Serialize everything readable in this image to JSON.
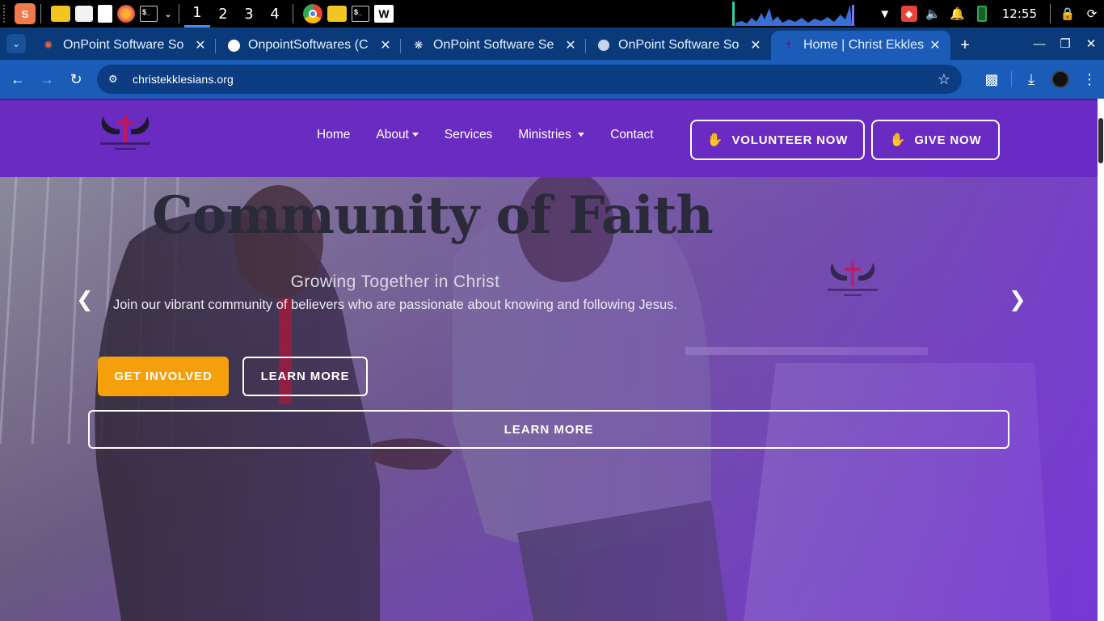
{
  "taskbar": {
    "workspaces": [
      "1",
      "2",
      "3",
      "4"
    ],
    "active_workspace": "1",
    "clock": "12:55"
  },
  "browser": {
    "tabs": [
      {
        "title": "OnPoint Software So",
        "icon": "onpoint-spark-icon",
        "active": false
      },
      {
        "title": "OnpointSoftwares (C",
        "icon": "github-icon",
        "active": false
      },
      {
        "title": "OnPoint Software Se",
        "icon": "openai-icon",
        "active": false
      },
      {
        "title": "OnPoint Software So",
        "icon": "globe-icon",
        "active": false
      },
      {
        "title": "Home | Christ Ekkles",
        "icon": "site-favicon-icon",
        "active": true
      }
    ],
    "url": "christekklesians.org"
  },
  "site": {
    "nav": {
      "links": [
        "Home",
        "About",
        "Services",
        "Ministries",
        "Contact"
      ],
      "volunteer_label": "VOLUNTEER NOW",
      "give_label": "GIVE NOW"
    },
    "hero": {
      "title": "Community of Faith",
      "subtitle": "Growing Together in Christ",
      "description": "Join our vibrant community of believers who are passionate about knowing and following Jesus.",
      "get_involved_label": "GET INVOLVED",
      "learn_more_label": "LEARN MORE",
      "learn_more_wide_label": "LEARN MORE"
    }
  },
  "colors": {
    "nav_purple": "#6a2bc0",
    "accent_orange": "#f5a00a",
    "browser_blue": "#1a5cb8"
  }
}
